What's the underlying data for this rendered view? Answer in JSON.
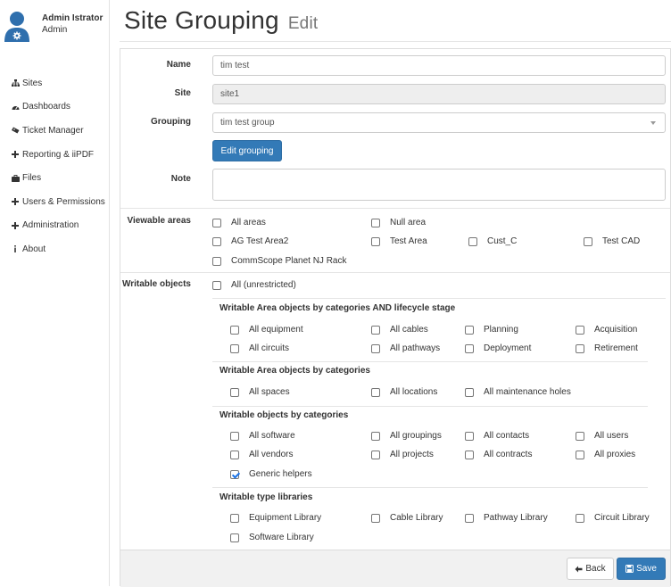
{
  "user": {
    "name": "Admin Istrator",
    "role": "Admin"
  },
  "nav": [
    {
      "label": "Sites",
      "icon": "sitemap-icon"
    },
    {
      "label": "Dashboards",
      "icon": "dashboard-icon"
    },
    {
      "label": "Ticket Manager",
      "icon": "ticket-icon"
    },
    {
      "label": "Reporting & iiPDF",
      "icon": "plus-icon"
    },
    {
      "label": "Files",
      "icon": "briefcase-icon"
    },
    {
      "label": "Users & Permissions",
      "icon": "plus-icon"
    },
    {
      "label": "Administration",
      "icon": "plus-icon"
    },
    {
      "label": "About",
      "icon": "info-icon"
    }
  ],
  "header": {
    "title": "Site Grouping",
    "subtitle": "Edit"
  },
  "form": {
    "name_label": "Name",
    "name_value": "tim test",
    "site_label": "Site",
    "site_value": "site1",
    "grouping_label": "Grouping",
    "grouping_value": "tim test group",
    "edit_grouping_button": "Edit grouping",
    "note_label": "Note",
    "note_value": "",
    "viewable_label": "Viewable areas",
    "viewable": [
      "All areas",
      "Null area",
      "AG Test Area2",
      "Test Area",
      "Cust_C",
      "Test CAD",
      "CommScope Planet NJ Rack"
    ],
    "writable_label": "Writable objects",
    "writable_all": "All (unrestricted)",
    "section_lifecycle": {
      "title": "Writable Area objects by categories AND lifecycle stage",
      "items": [
        "All equipment",
        "All cables",
        "Planning",
        "Acquisition",
        "All circuits",
        "All pathways",
        "Deployment",
        "Retirement"
      ]
    },
    "section_area": {
      "title": "Writable Area objects by categories",
      "items": [
        "All spaces",
        "All locations",
        "All maintenance holes"
      ]
    },
    "section_objects": {
      "title": "Writable objects by categories",
      "items": [
        "All software",
        "All groupings",
        "All contacts",
        "All users",
        "All vendors",
        "All projects",
        "All contracts",
        "All proxies",
        "Generic helpers"
      ],
      "checked": [
        "Generic helpers"
      ]
    },
    "section_libraries": {
      "title": "Writable type libraries",
      "items": [
        "Equipment Library",
        "Cable Library",
        "Pathway Library",
        "Circuit Library",
        "Software Library"
      ]
    }
  },
  "footer": {
    "back_label": "Back",
    "save_label": "Save"
  },
  "colors": {
    "primary": "#337ab7",
    "avatar": "#2f6fad",
    "footer_bg": "#f1f1f1"
  }
}
